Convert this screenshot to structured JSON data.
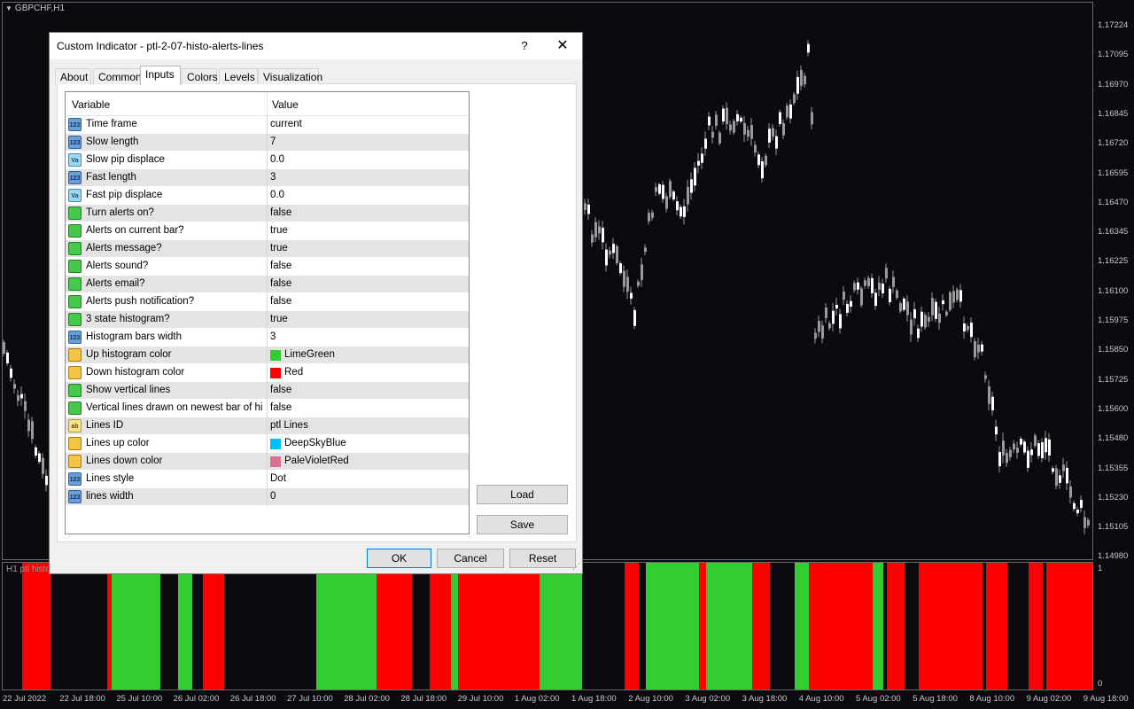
{
  "chart": {
    "symbol": "GBPCHF,H1",
    "indicator_label": "H1 ptl histo",
    "price_ticks": [
      "1.17224",
      "1.17095",
      "1.16970",
      "1.16845",
      "1.16720",
      "1.16595",
      "1.16470",
      "1.16345",
      "1.16225",
      "1.16100",
      "1.15975",
      "1.15850",
      "1.15725",
      "1.15600",
      "1.15480",
      "1.15355",
      "1.15230",
      "1.15105",
      "1.14980"
    ],
    "sub_ticks": [
      "1",
      "0"
    ],
    "time_ticks": [
      "22 Jul 2022",
      "22 Jul 18:00",
      "25 Jul 10:00",
      "26 Jul 02:00",
      "26 Jul 18:00",
      "27 Jul 10:00",
      "28 Jul 02:00",
      "28 Jul 18:00",
      "29 Jul 10:00",
      "1 Aug 02:00",
      "1 Aug 18:00",
      "2 Aug 10:00",
      "3 Aug 02:00",
      "3 Aug 18:00",
      "4 Aug 10:00",
      "5 Aug 02:00",
      "5 Aug 18:00",
      "8 Aug 10:00",
      "9 Aug 02:00",
      "9 Aug 18:00"
    ],
    "colors": {
      "up": "#32cd32",
      "down": "#ff0000",
      "candle": "#9a9a9a",
      "background": "#0b0b0f"
    }
  },
  "dialog": {
    "title": "Custom Indicator - ptl-2-07-histo-alerts-lines",
    "help_label": "?",
    "close_label": "✕",
    "tabs": [
      {
        "label": "About"
      },
      {
        "label": "Common"
      },
      {
        "label": "Inputs"
      },
      {
        "label": "Colors"
      },
      {
        "label": "Levels"
      },
      {
        "label": "Visualization"
      }
    ],
    "active_tab": "Inputs",
    "grid": {
      "headers": {
        "variable": "Variable",
        "value": "Value"
      },
      "rows": [
        {
          "icon": "int",
          "icon_text": "123",
          "name": "Time frame",
          "value": "current"
        },
        {
          "icon": "int",
          "icon_text": "123",
          "name": "Slow length",
          "value": "7"
        },
        {
          "icon": "dbl",
          "icon_text": "Va",
          "name": "Slow pip displace",
          "value": "0.0"
        },
        {
          "icon": "int",
          "icon_text": "123",
          "name": "Fast length",
          "value": "3"
        },
        {
          "icon": "dbl",
          "icon_text": "Va",
          "name": "Fast pip displace",
          "value": "0.0"
        },
        {
          "icon": "bool",
          "icon_text": "",
          "name": "Turn alerts on?",
          "value": "false"
        },
        {
          "icon": "bool",
          "icon_text": "",
          "name": "Alerts on current bar?",
          "value": "true"
        },
        {
          "icon": "bool",
          "icon_text": "",
          "name": "Alerts message?",
          "value": "true"
        },
        {
          "icon": "bool",
          "icon_text": "",
          "name": "Alerts sound?",
          "value": "false"
        },
        {
          "icon": "bool",
          "icon_text": "",
          "name": "Alerts email?",
          "value": "false"
        },
        {
          "icon": "bool",
          "icon_text": "",
          "name": "Alerts push notification?",
          "value": "false"
        },
        {
          "icon": "bool",
          "icon_text": "",
          "name": "3 state histogram?",
          "value": "true"
        },
        {
          "icon": "int",
          "icon_text": "123",
          "name": "Histogram bars width",
          "value": "3"
        },
        {
          "icon": "color",
          "icon_text": "",
          "name": "Up histogram color",
          "value": "LimeGreen",
          "swatch": "#32cd32"
        },
        {
          "icon": "color",
          "icon_text": "",
          "name": "Down histogram color",
          "value": "Red",
          "swatch": "#ff0000"
        },
        {
          "icon": "bool",
          "icon_text": "",
          "name": "Show vertical lines",
          "value": "false"
        },
        {
          "icon": "bool",
          "icon_text": "",
          "name": "Vertical lines drawn on newest bar of hig...",
          "value": "false"
        },
        {
          "icon": "str",
          "icon_text": "ab",
          "name": "Lines ID",
          "value": "ptl Lines"
        },
        {
          "icon": "color",
          "icon_text": "",
          "name": "Lines up color",
          "value": "DeepSkyBlue",
          "swatch": "#00bfff"
        },
        {
          "icon": "color",
          "icon_text": "",
          "name": "Lines down color",
          "value": "PaleVioletRed",
          "swatch": "#db7093"
        },
        {
          "icon": "int",
          "icon_text": "123",
          "name": "Lines style",
          "value": "Dot"
        },
        {
          "icon": "int",
          "icon_text": "123",
          "name": "lines width",
          "value": "0"
        }
      ]
    },
    "buttons": {
      "load": "Load",
      "save": "Save",
      "ok": "OK",
      "cancel": "Cancel",
      "reset": "Reset"
    },
    "grip": "⋰"
  }
}
